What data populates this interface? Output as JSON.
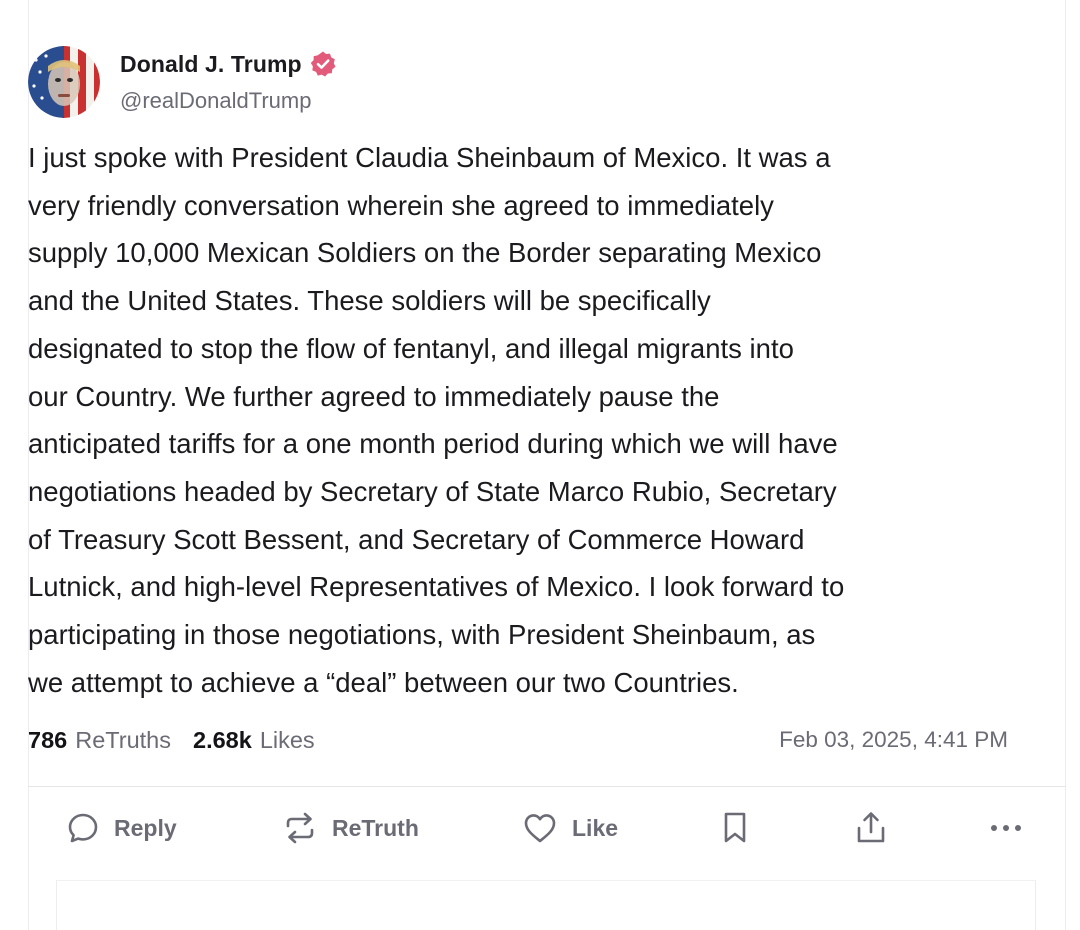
{
  "post": {
    "author": {
      "display_name": "Donald J. Trump",
      "handle": "@realDonaldTrump",
      "verified": true,
      "avatar_icon": "avatar-flag-portrait"
    },
    "text": "I just spoke with President Claudia Sheinbaum of Mexico. It was a\nvery friendly conversation wherein she agreed to immediately\nsupply 10,000 Mexican Soldiers on the Border separating Mexico\nand the United States. These soldiers will be specifically\ndesignated to stop the flow of fentanyl, and illegal migrants into\nour Country. We further agreed to immediately pause the\nanticipated tariffs for a one month period during which we will have\nnegotiations headed by Secretary of State Marco Rubio, Secretary\nof Treasury Scott Bessent, and Secretary of Commerce Howard\nLutnick, and high-level Representatives of Mexico. I look forward to\nparticipating in those negotiations, with President Sheinbaum, as\nwe attempt to achieve a “deal” between our two Countries.",
    "stats": {
      "retruths_count": "786",
      "retruths_label": "ReTruths",
      "likes_count": "2.68k",
      "likes_label": "Likes"
    },
    "timestamp": "Feb 03, 2025, 4:41 PM"
  },
  "actions": {
    "reply_label": "Reply",
    "retruth_label": "ReTruth",
    "like_label": "Like"
  },
  "colors": {
    "verified_badge": "#e35b7a",
    "muted_text": "#6b6b75",
    "icon_gray": "#6b6b75"
  }
}
